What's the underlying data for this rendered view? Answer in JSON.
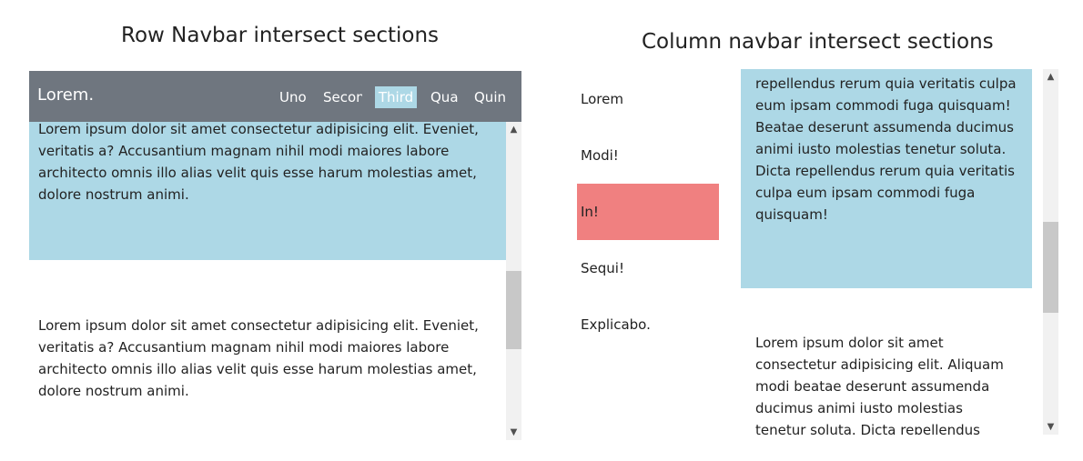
{
  "left": {
    "heading": "Row Navbar intersect sections",
    "brand": "Lorem.",
    "nav_items": [
      "Uno",
      "Secon",
      "Third",
      "Qua",
      "Quin"
    ],
    "active_nav": "Third",
    "sections": [
      "Lorem ipsum dolor sit amet consectetur adipisicing elit. Eveniet, veritatis a? Accusantium magnam nihil modi maiores labore architecto omnis illo alias velit quis esse harum molestias amet, dolore nostrum animi.",
      "Lorem ipsum dolor sit amet consectetur adipisicing elit. Eveniet, veritatis a? Accusantium magnam nihil modi maiores labore architecto omnis illo alias velit quis esse harum molestias amet, dolore nostrum animi."
    ]
  },
  "right": {
    "heading": "Column navbar intersect sections",
    "nav_items": [
      "Lorem",
      "Modi!",
      "In!",
      "Sequi!",
      "Explicabo."
    ],
    "active_nav": "In!",
    "sections": [
      "iusto molestias tenetur soluta. Dicta repellendus rerum quia veritatis culpa eum ipsam commodi fuga quisquam! Beatae deserunt assumenda ducimus animi iusto molestias tenetur soluta. Dicta repellendus rerum quia veritatis culpa eum ipsam commodi fuga quisquam!",
      "Lorem ipsum dolor sit amet consectetur adipisicing elit. Aliquam modi beatae deserunt assumenda ducimus animi iusto molestias tenetur soluta. Dicta repellendus rerum quia veritatis culpa"
    ]
  },
  "colors": {
    "navbar_bg": "#6f767f",
    "section_blue": "#add8e6",
    "active_side": "#f08080",
    "scroll_track": "#f1f1f1",
    "scroll_thumb": "#c8c8c8"
  },
  "icons": {
    "scroll_up": "chevron-up-icon",
    "scroll_down": "chevron-down-icon"
  }
}
